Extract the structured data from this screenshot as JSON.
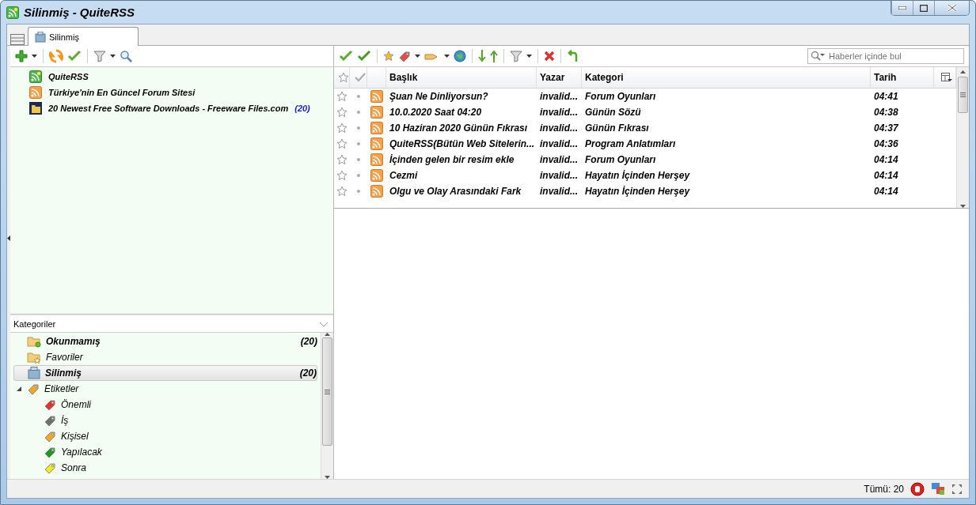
{
  "window": {
    "title": "Silinmiş - QuiteRSS"
  },
  "tabs": [
    {
      "label": "Silinmiş",
      "selected": true
    }
  ],
  "feeds": [
    {
      "kind": "quiterss",
      "name": "QuiteRSS",
      "unread": true
    },
    {
      "kind": "rss",
      "name": "Türkiye'nin En Güncel Forum Sitesi",
      "unread": true
    },
    {
      "kind": "folder",
      "name": "20 Newest Free Software Downloads - Freeware Files.com",
      "count": "(20)",
      "unread": true
    }
  ],
  "categories_header": "Kategoriler",
  "categories": [
    {
      "kind": "unread",
      "name": "Okunmamış",
      "count": "(20)",
      "unread": true,
      "selected": false
    },
    {
      "kind": "starred",
      "name": "Favoriler",
      "unread": false,
      "selected": false
    },
    {
      "kind": "deleted",
      "name": "Silinmiş",
      "count": "(20)",
      "unread": true,
      "selected": true
    },
    {
      "kind": "labels",
      "name": "Etiketler",
      "unread": false,
      "selected": false,
      "expanded": true,
      "color": "#f5a623",
      "children": [
        {
          "name": "Önemli",
          "color": "#e83030"
        },
        {
          "name": "İş",
          "color": "#707070"
        },
        {
          "name": "Kişisel",
          "color": "#f5a623"
        },
        {
          "name": "Yapılacak",
          "color": "#1e9a1e"
        },
        {
          "name": "Sonra",
          "color": "#f2ea20"
        }
      ]
    }
  ],
  "search": {
    "placeholder": "Haberler içinde bul"
  },
  "table": {
    "columns": [
      "Başlık",
      "Yazar",
      "Kategori",
      "Tarih"
    ],
    "rows": [
      {
        "starred": false,
        "title": "Şuan Ne Dinliyorsun?",
        "author": "invalid...",
        "category": "Forum Oyunları",
        "date": "04:41"
      },
      {
        "starred": false,
        "title": "10.0.2020 Saat 04:20",
        "author": "invalid...",
        "category": "Günün Sözü",
        "date": "04:38"
      },
      {
        "starred": false,
        "title": "10 Haziran 2020 Günün Fıkrası",
        "author": "invalid...",
        "category": "Günün Fıkrası",
        "date": "04:37"
      },
      {
        "starred": false,
        "title": "QuiteRSS(Bütün Web Sitelerin...",
        "author": "invalid...",
        "category": "Program Anlatımları",
        "date": "04:36"
      },
      {
        "starred": false,
        "title": "İçinden gelen bir resim ekle",
        "author": "invalid...",
        "category": "Forum Oyunları",
        "date": "04:14"
      },
      {
        "starred": false,
        "title": "Cezmi",
        "author": "invalid...",
        "category": "Hayatın İçinden Herşey",
        "date": "04:14"
      },
      {
        "starred": false,
        "title": "Olgu ve Olay Arasındaki Fark",
        "author": "invalid...",
        "category": "Hayatın İçinden Herşey",
        "date": "04:14"
      }
    ]
  },
  "status_bar": {
    "total": "Tümü: 20"
  }
}
